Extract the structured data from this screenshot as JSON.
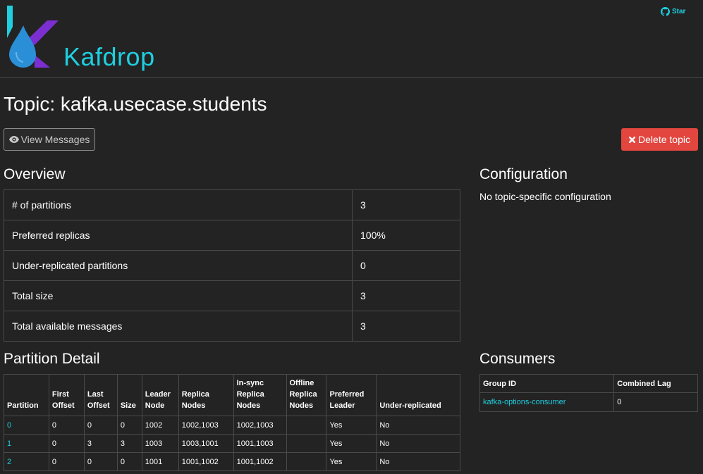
{
  "header": {
    "brand": "Kafdrop",
    "star_label": "Star",
    "colors": {
      "accent": "#1ecfe0",
      "logo_cyan": "#1ecfe0",
      "logo_blue": "#2a8fd6",
      "logo_purple": "#7b2fd0"
    }
  },
  "topic": {
    "title": "Topic: kafka.usecase.students"
  },
  "buttons": {
    "view_messages": "View Messages",
    "delete_topic": "Delete topic"
  },
  "overview": {
    "heading": "Overview",
    "rows": [
      {
        "label": "# of partitions",
        "value": "3"
      },
      {
        "label": "Preferred replicas",
        "value": "100%"
      },
      {
        "label": "Under-replicated partitions",
        "value": "0"
      },
      {
        "label": "Total size",
        "value": "3"
      },
      {
        "label": "Total available messages",
        "value": "3"
      }
    ]
  },
  "configuration": {
    "heading": "Configuration",
    "text": "No topic-specific configuration"
  },
  "partition_detail": {
    "heading": "Partition Detail",
    "headers": [
      "Partition",
      "First\nOffset",
      "Last\nOffset",
      "Size",
      "Leader\nNode",
      "Replica\nNodes",
      "In-sync\nReplica\nNodes",
      "Offline\nReplica\nNodes",
      "Preferred\nLeader",
      "Under-replicated"
    ],
    "rows": [
      [
        "0",
        "0",
        "0",
        "0",
        "1002",
        "1002,1003",
        "1002,1003",
        "",
        "Yes",
        "No"
      ],
      [
        "1",
        "0",
        "3",
        "3",
        "1003",
        "1003,1001",
        "1001,1003",
        "",
        "Yes",
        "No"
      ],
      [
        "2",
        "0",
        "0",
        "0",
        "1001",
        "1001,1002",
        "1001,1002",
        "",
        "Yes",
        "No"
      ]
    ]
  },
  "consumers": {
    "heading": "Consumers",
    "headers": [
      "Group ID",
      "Combined Lag"
    ],
    "rows": [
      [
        "kafka-options-consumer",
        "0"
      ]
    ]
  }
}
